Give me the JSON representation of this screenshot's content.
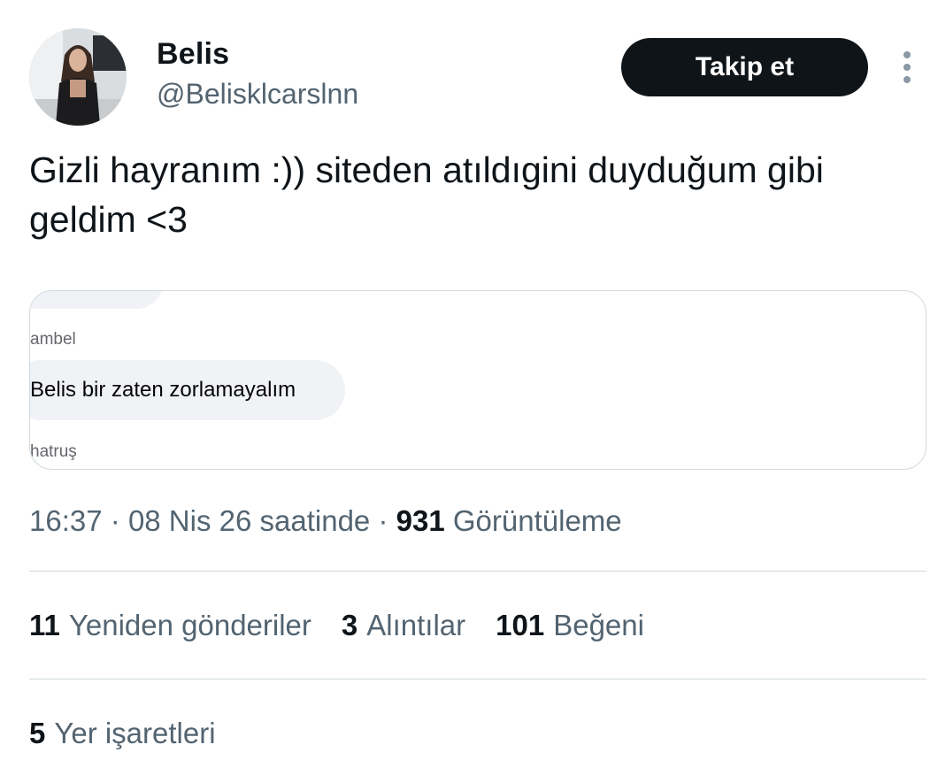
{
  "author": {
    "display_name": "Belis",
    "handle": "@Belisklcarslnn",
    "avatar_icon": "profile-photo"
  },
  "actions": {
    "follow_label": "Takip et",
    "more_icon": "vertical-ellipsis-icon"
  },
  "tweet": {
    "text_line1": "Gizli hayranım :)) siteden atıldıgini duyduğum gibi",
    "text_line2": "geldim <3"
  },
  "media": {
    "sender_top": "ambel",
    "message": "Belis bir zaten zorlamayalım",
    "sender_bottom": "hatruş"
  },
  "meta": {
    "time": "16:37",
    "date": "08 Nis 26 saatinde",
    "views_count": "931",
    "views_label": "Görüntüleme",
    "separator": "·"
  },
  "stats": {
    "retweets_count": "11",
    "retweets_label": "Yeniden gönderiler",
    "quotes_count": "3",
    "quotes_label": "Alıntılar",
    "likes_count": "101",
    "likes_label": "Beğeni",
    "bookmarks_count": "5",
    "bookmarks_label": "Yer işaretleri"
  },
  "colors": {
    "text_primary": "#0f1419",
    "text_secondary": "#536471",
    "button_bg": "#0f1419",
    "border": "#cfd9de"
  }
}
